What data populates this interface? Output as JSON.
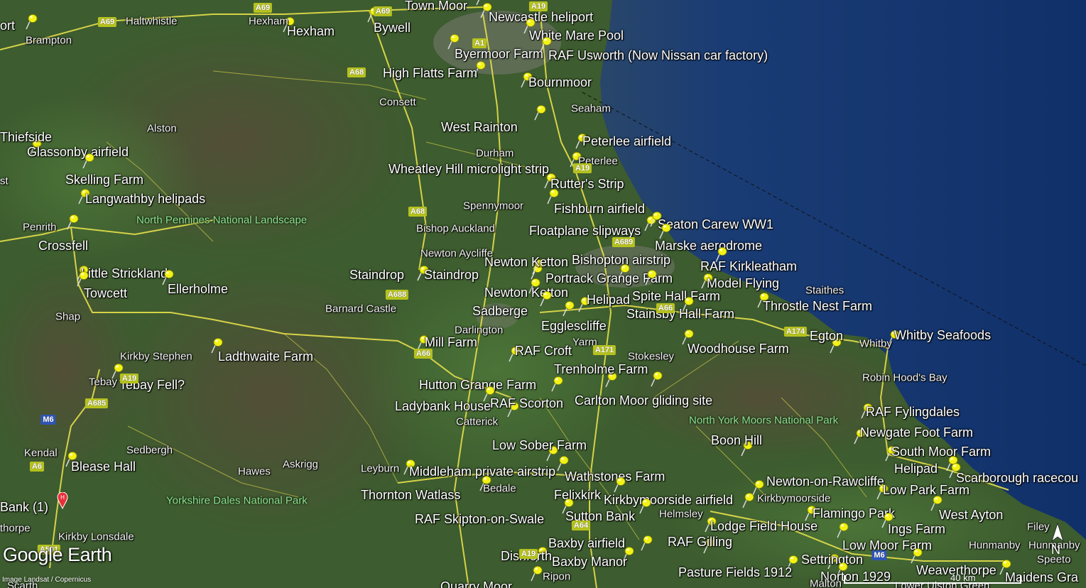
{
  "app": {
    "logo_text": "Google Earth",
    "imagery_credit": "Image Landsat / Copernicus"
  },
  "colors": {
    "land": "#3b5a2d",
    "sea": "#14346e",
    "roads": "#e6e04a",
    "pins": "#f2f216",
    "park_label": "#8fe08f"
  },
  "scale_bar": {
    "label": "40 km"
  },
  "compass": {
    "label": "N"
  },
  "pin_labels": [
    "Town Moor",
    "Newcastle heliport",
    "White Mare Pool",
    "Byermoor Farm",
    "RAF Usworth  (Now Nissan car factory)",
    "Hexham",
    "Bywell",
    "High Flatts Farm",
    "Bournmoor",
    "West Rainton",
    "Peterlee airfield",
    "Wheatley Hill microlight strip",
    "Rutter's Strip",
    "Fishburn airfield",
    "Floatplane slipways",
    "Seaton Carew WW1",
    "Marske aerodrome",
    "Bishopton airstrip",
    "RAF Kirkleatham",
    "Newton Ketton",
    "Portrack Grange Farm",
    "Model Flying",
    "Newton Ketton",
    "Spite Hall Farm",
    "Helipad",
    "Throstle Nest Farm",
    "Stainsby Hall Farm",
    "Sadberge",
    "Egglescliffe",
    "Staindrop",
    "Staindrop",
    "Egton",
    "Whitby Seafoods",
    "Mill Farm",
    "RAF Croft",
    "Woodhouse Farm",
    "Trenholme Farm",
    "Hutton Grange Farm",
    "Carlton Moor gliding site",
    "Ladybank House",
    "RAF Scorton",
    "RAF Fylingdales",
    "Newgate Foot Farm",
    "Boon Hill",
    "Low Sober Farm",
    "South Moor Farm",
    "Helipad",
    "Scarborough racecou",
    "Middleham private airstrip",
    "Wathstones Farm",
    "Newton-on-Rawcliffe",
    "Kirkbymoorside airfield",
    "Low Park Farm",
    "Thornton Watlass",
    "Felixkirk",
    "Flamingo Park",
    "West Ayton",
    "RAF Skipton-on-Swale",
    "Sutton Bank",
    "Lodge Field House",
    "Ings Farm",
    "Baxby airfield",
    "RAF Gilling",
    "Low Moor Farm",
    "Dishforth",
    "Baxby Manor",
    "Settrington",
    "Weaverthorpe",
    "Pasture Fields 1912",
    "Norton 1929",
    "Maidens Gra",
    "Quarry Moor",
    "Glassonby airfield",
    "Thiefside",
    "Skelling Farm",
    "Langwathby helipads",
    "Crossfell",
    "Little Strickland",
    "Towcett",
    "Ellerholme",
    "Ladthwaite Farm",
    "Tebay Fell?",
    "Blease Hall",
    "Bank (1)",
    "ort"
  ],
  "town_labels": [
    "Haltwhistle",
    "Hexham",
    "Brampton",
    "Consett",
    "Alston",
    "Seaham",
    "Durham",
    "Peterlee",
    "Spennymoor",
    "Bishop Auckland",
    "Newton Aycliffe",
    "Penrith",
    "Shap",
    "Barnard Castle",
    "Darlington",
    "Yarm",
    "Stokesley",
    "Staithes",
    "Whitby",
    "Robin Hood's Bay",
    "Kirkby Stephen",
    "Tebay",
    "Catterick",
    "Kendal",
    "Sedbergh",
    "Hawes",
    "Askrigg",
    "Leyburn",
    "Bedale",
    "Kirkbymoorside",
    "Helmsley",
    "Filey",
    "Hunmanby",
    "Hunmanby",
    "Speeto",
    "Kirkby Lonsdale",
    "Ripon",
    "Malton",
    "Lower Ulston Green",
    "thorpe",
    "st",
    "Scarth"
  ],
  "park_labels": [
    "North Pennines National Landscape",
    "Yorkshire Dales National Park",
    "North York Moors National Park"
  ],
  "road_shields": [
    "A69",
    "A69",
    "A69",
    "A19",
    "A1",
    "A68",
    "A68",
    "A19",
    "A689",
    "A688",
    "A66",
    "A66",
    "A174",
    "A171",
    "A19",
    "A685",
    "M6",
    "A6",
    "A591",
    "M6",
    "A64",
    "A19"
  ]
}
